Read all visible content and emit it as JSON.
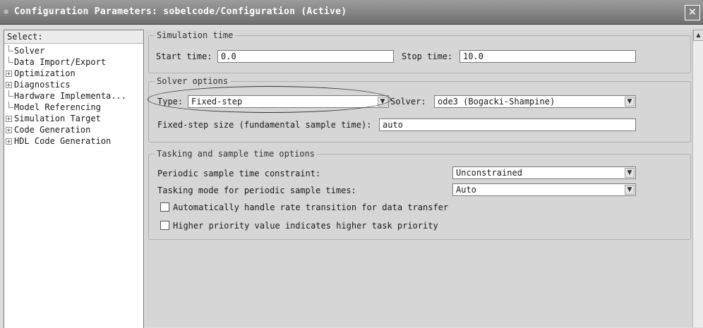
{
  "window": {
    "title": "Configuration Parameters: sobelcode/Configuration (Active)",
    "title_icon": "gear-icon",
    "close_glyph": "✕"
  },
  "sidebar": {
    "select_label": "Select:",
    "items": [
      {
        "label": "Solver",
        "expandable": false
      },
      {
        "label": "Data Import/Export",
        "expandable": false
      },
      {
        "label": "Optimization",
        "expandable": true
      },
      {
        "label": "Diagnostics",
        "expandable": true
      },
      {
        "label": "Hardware Implementa...",
        "expandable": false
      },
      {
        "label": "Model Referencing",
        "expandable": false
      },
      {
        "label": "Simulation Target",
        "expandable": true
      },
      {
        "label": "Code Generation",
        "expandable": true
      },
      {
        "label": "HDL Code Generation",
        "expandable": true
      }
    ]
  },
  "simulation_time": {
    "title": "Simulation time",
    "start_label": "Start time:",
    "start_value": "0.0",
    "stop_label": "Stop time:",
    "stop_value": "10.0"
  },
  "solver_options": {
    "title": "Solver options",
    "type_label": "Type:",
    "type_value": "Fixed-step",
    "solver_label": "Solver:",
    "solver_value": "ode3 (Bogacki-Shampine)",
    "step_label": "Fixed-step size (fundamental sample time):",
    "step_value": "auto"
  },
  "tasking": {
    "title": "Tasking and sample time options",
    "periodic_label": "Periodic sample time constraint:",
    "periodic_value": "Unconstrained",
    "mode_label": "Tasking mode for periodic sample times:",
    "mode_value": "Auto",
    "checkbox1_label": "Automatically handle rate transition for data transfer",
    "checkbox2_label": "Higher priority value indicates higher task priority"
  }
}
